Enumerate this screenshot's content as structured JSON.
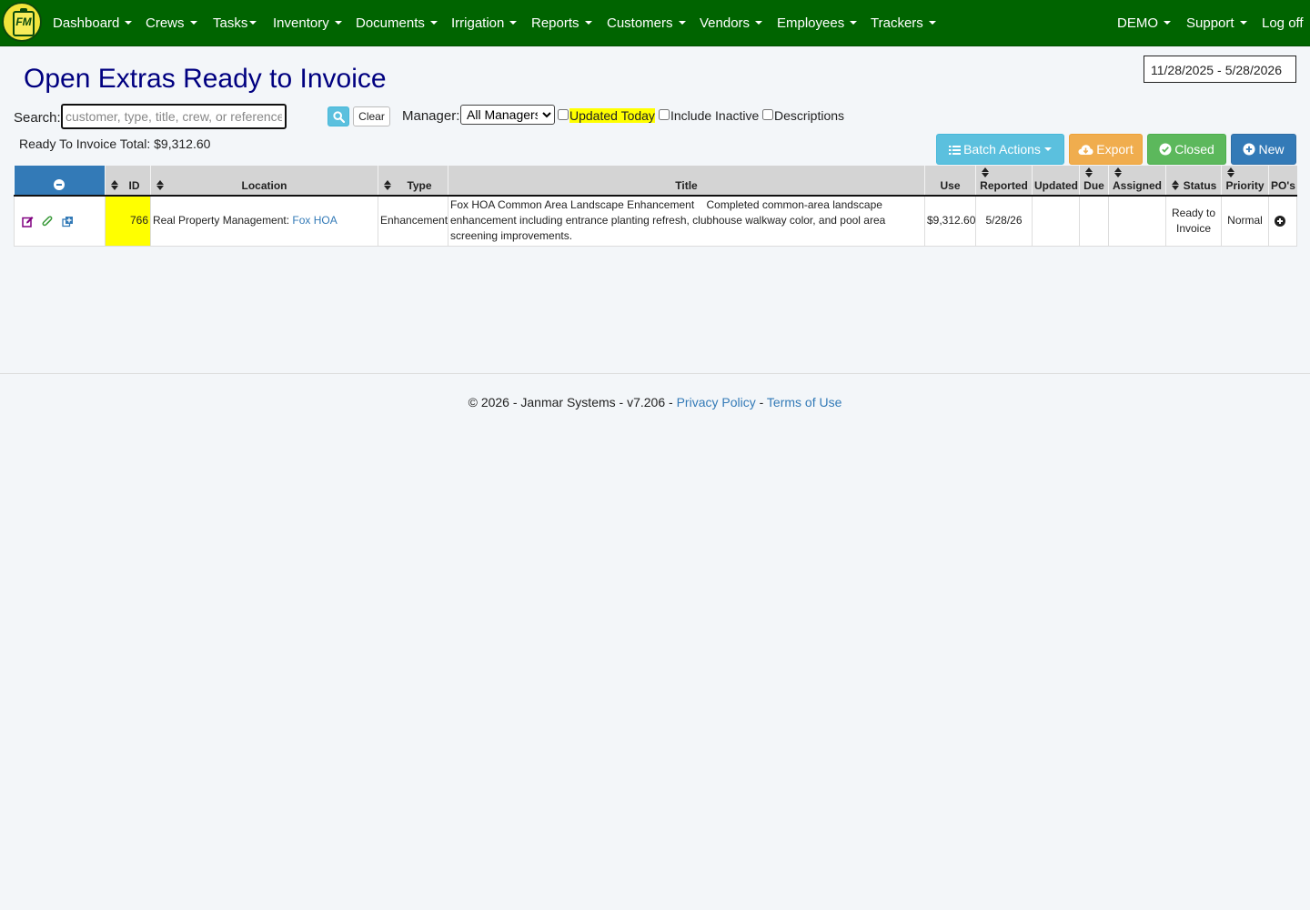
{
  "nav": {
    "logo_text": "FM",
    "items": [
      "Dashboard",
      "Crews",
      "Tasks",
      "Inventory",
      "Documents",
      "Irrigation",
      "Reports",
      "Customers",
      "Vendors",
      "Employees",
      "Trackers"
    ],
    "right_items": [
      "DEMO",
      "Support"
    ],
    "logoff": "Log off"
  },
  "page": {
    "title": "Open Extras Ready to Invoice",
    "date_from": "11/28/2025",
    "date_sep": "-",
    "date_to": "5/28/2026"
  },
  "filters": {
    "search_label": "Search:",
    "search_placeholder": "customer, type, title, crew, or reference",
    "search_value": "",
    "clear_label": "Clear",
    "manager_label": "Manager:",
    "manager_selected": "All Managers",
    "updated_today": "Updated Today",
    "include_inactive": "Include Inactive",
    "descriptions": "Descriptions"
  },
  "summary": {
    "total_label": "Ready To Invoice Total:",
    "total_value": "$9,312.60"
  },
  "actions": {
    "batch": "Batch Actions",
    "export": "Export",
    "closed": "Closed",
    "new": "New"
  },
  "table": {
    "headers": {
      "id": "ID",
      "location": "Location",
      "type": "Type",
      "title": "Title",
      "use": "Use",
      "reported": "Reported",
      "updated": "Updated",
      "due": "Due",
      "assigned": "Assigned",
      "status": "Status",
      "priority": "Priority",
      "pos": "PO's"
    },
    "rows": [
      {
        "id": "766",
        "location_company": "Real Property Management:",
        "location_site": "Fox HOA",
        "type": "Enhancement",
        "title": "Fox HOA Common Area Landscape Enhancement",
        "description": "Completed common-area landscape enhancement including entrance planting refresh, clubhouse walkway color, and pool area screening improvements.",
        "use": "$9,312.60",
        "reported": "5/28/26",
        "updated": "",
        "due": "",
        "assigned": "",
        "status": "Ready to Invoice",
        "priority": "Normal"
      }
    ]
  },
  "footer": {
    "text": "© 2026 - Janmar Systems - v7.206 -",
    "privacy": "Privacy Policy",
    "sep": "-",
    "terms": "Terms of Use"
  },
  "colors": {
    "navbar": "#006400",
    "title": "#000080",
    "highlight": "#ffff00",
    "info": "#5bc0de",
    "warning": "#f0ad4e",
    "success": "#5cb85c",
    "primary": "#337ab7"
  }
}
